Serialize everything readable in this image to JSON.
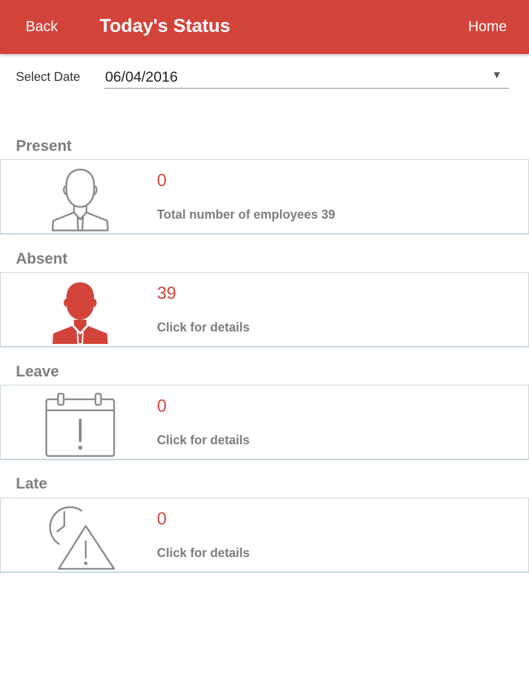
{
  "header": {
    "back_label": "Back",
    "title": "Today's Status",
    "home_label": "Home"
  },
  "date": {
    "label": "Select Date",
    "value": "06/04/2016"
  },
  "sections": [
    {
      "title": "Present",
      "count": "0",
      "subtitle": "Total number of employees 39",
      "icon": "person-outline-icon"
    },
    {
      "title": "Absent",
      "count": "39",
      "subtitle": "Click for details",
      "icon": "person-filled-icon"
    },
    {
      "title": "Leave",
      "count": "0",
      "subtitle": "Click for details",
      "icon": "calendar-alert-icon"
    },
    {
      "title": "Late",
      "count": "0",
      "subtitle": "Click for details",
      "icon": "clock-warning-icon"
    }
  ],
  "colors": {
    "accent": "#d2443a",
    "muted_text": "#7d7d7d",
    "icon_gray": "#8a8a8a",
    "card_border": "#c7d5de"
  }
}
